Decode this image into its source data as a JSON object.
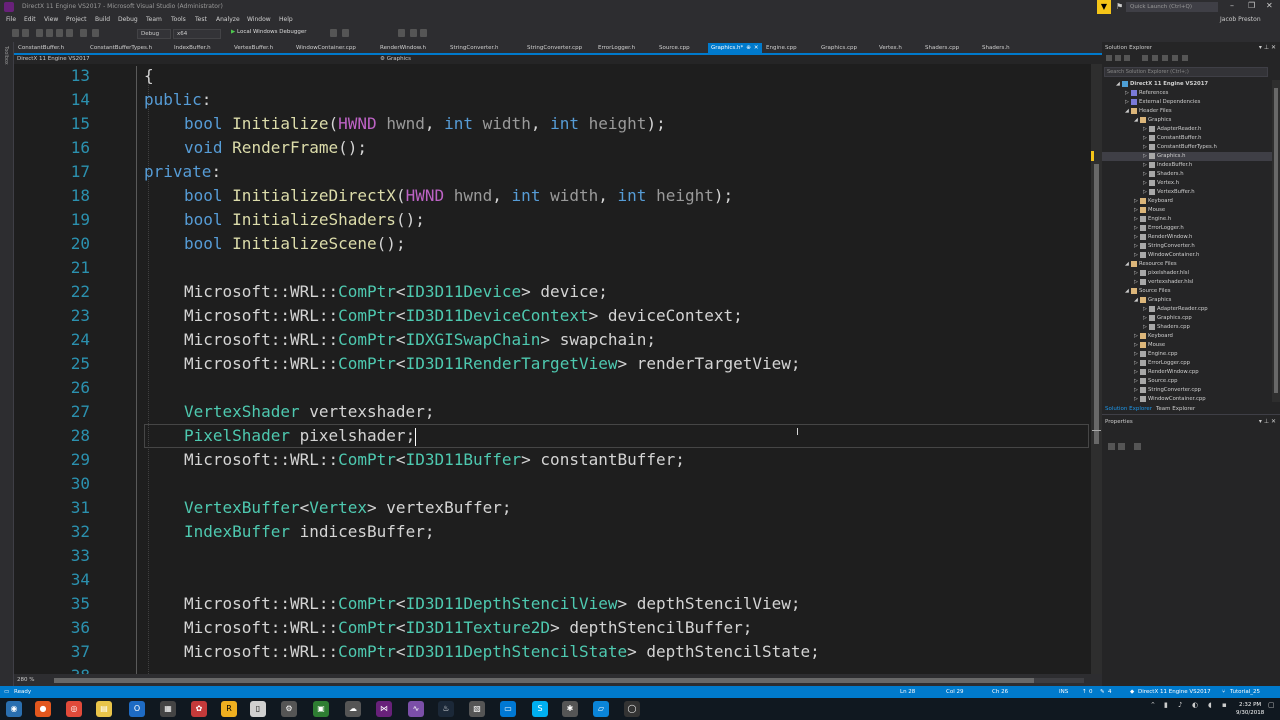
{
  "window": {
    "title": "DirectX 11 Engine VS2017 - Microsoft Visual Studio (Administrator)",
    "quick_launch": "Quick Launch (Ctrl+Q)",
    "user": "Jacob Preston"
  },
  "menu": [
    "File",
    "Edit",
    "View",
    "Project",
    "Build",
    "Debug",
    "Team",
    "Tools",
    "Test",
    "Analyze",
    "Window",
    "Help"
  ],
  "toolbar": {
    "config": "Debug",
    "platform": "x64",
    "start_label": "Local Windows Debugger"
  },
  "toolbox_label": "Toolbox",
  "tabs": [
    {
      "label": "ConstantBuffer.h"
    },
    {
      "label": "ConstantBufferTypes.h"
    },
    {
      "label": "IndexBuffer.h"
    },
    {
      "label": "VertexBuffer.h"
    },
    {
      "label": "WindowContainer.cpp"
    },
    {
      "label": "RenderWindow.h"
    },
    {
      "label": "StringConverter.h"
    },
    {
      "label": "StringConverter.cpp"
    },
    {
      "label": "ErrorLogger.h"
    },
    {
      "label": "Source.cpp"
    },
    {
      "label": "Graphics.h*",
      "active": true
    },
    {
      "label": "Engine.cpp"
    },
    {
      "label": "Graphics.cpp"
    },
    {
      "label": "Vertex.h"
    },
    {
      "label": "Shaders.cpp"
    },
    {
      "label": "Shaders.h"
    }
  ],
  "navbar": {
    "project": "DirectX 11 Engine VS2017",
    "scope": "Graphics"
  },
  "editor": {
    "zoom": "280 %",
    "lines": [
      {
        "n": "13",
        "tokens": [
          [
            "pl",
            "{"
          ]
        ]
      },
      {
        "n": "14",
        "tokens": [
          [
            "kw",
            "public"
          ],
          [
            "pl",
            ":"
          ]
        ]
      },
      {
        "n": "15",
        "indent": 1,
        "tokens": [
          [
            "kw",
            "bool"
          ],
          [
            "pl",
            " "
          ],
          [
            "fn",
            "Initialize"
          ],
          [
            "pl",
            "("
          ],
          [
            "mac",
            "HWND"
          ],
          [
            "pl",
            " "
          ],
          [
            "prm",
            "hwnd"
          ],
          [
            "pl",
            ", "
          ],
          [
            "kw",
            "int"
          ],
          [
            "pl",
            " "
          ],
          [
            "prm",
            "width"
          ],
          [
            "pl",
            ", "
          ],
          [
            "kw",
            "int"
          ],
          [
            "pl",
            " "
          ],
          [
            "prm",
            "height"
          ],
          [
            "pl",
            ");"
          ]
        ]
      },
      {
        "n": "16",
        "indent": 1,
        "tokens": [
          [
            "kw",
            "void"
          ],
          [
            "pl",
            " "
          ],
          [
            "fn",
            "RenderFrame"
          ],
          [
            "pl",
            "();"
          ]
        ]
      },
      {
        "n": "17",
        "tokens": [
          [
            "kw",
            "private"
          ],
          [
            "pl",
            ":"
          ]
        ]
      },
      {
        "n": "18",
        "indent": 1,
        "tokens": [
          [
            "kw",
            "bool"
          ],
          [
            "pl",
            " "
          ],
          [
            "fn",
            "InitializeDirectX"
          ],
          [
            "pl",
            "("
          ],
          [
            "mac",
            "HWND"
          ],
          [
            "pl",
            " "
          ],
          [
            "prm",
            "hwnd"
          ],
          [
            "pl",
            ", "
          ],
          [
            "kw",
            "int"
          ],
          [
            "pl",
            " "
          ],
          [
            "prm",
            "width"
          ],
          [
            "pl",
            ", "
          ],
          [
            "kw",
            "int"
          ],
          [
            "pl",
            " "
          ],
          [
            "prm",
            "height"
          ],
          [
            "pl",
            ");"
          ]
        ]
      },
      {
        "n": "19",
        "indent": 1,
        "tokens": [
          [
            "kw",
            "bool"
          ],
          [
            "pl",
            " "
          ],
          [
            "fn",
            "InitializeShaders"
          ],
          [
            "pl",
            "();"
          ]
        ]
      },
      {
        "n": "20",
        "indent": 1,
        "tokens": [
          [
            "kw",
            "bool"
          ],
          [
            "pl",
            " "
          ],
          [
            "fn",
            "InitializeScene"
          ],
          [
            "pl",
            "();"
          ]
        ]
      },
      {
        "n": "21",
        "tokens": []
      },
      {
        "n": "22",
        "indent": 1,
        "tokens": [
          [
            "pl",
            "Microsoft::WRL::"
          ],
          [
            "ty",
            "ComPtr"
          ],
          [
            "pl",
            "<"
          ],
          [
            "ty",
            "ID3D11Device"
          ],
          [
            "pl",
            "> device;"
          ]
        ]
      },
      {
        "n": "23",
        "indent": 1,
        "tokens": [
          [
            "pl",
            "Microsoft::WRL::"
          ],
          [
            "ty",
            "ComPtr"
          ],
          [
            "pl",
            "<"
          ],
          [
            "ty",
            "ID3D11DeviceContext"
          ],
          [
            "pl",
            "> deviceContext;"
          ]
        ]
      },
      {
        "n": "24",
        "indent": 1,
        "tokens": [
          [
            "pl",
            "Microsoft::WRL::"
          ],
          [
            "ty",
            "ComPtr"
          ],
          [
            "pl",
            "<"
          ],
          [
            "ty",
            "IDXGISwapChain"
          ],
          [
            "pl",
            "> swapchain;"
          ]
        ]
      },
      {
        "n": "25",
        "indent": 1,
        "tokens": [
          [
            "pl",
            "Microsoft::WRL::"
          ],
          [
            "ty",
            "ComPtr"
          ],
          [
            "pl",
            "<"
          ],
          [
            "ty",
            "ID3D11RenderTargetView"
          ],
          [
            "pl",
            "> renderTargetView;"
          ]
        ]
      },
      {
        "n": "26",
        "tokens": []
      },
      {
        "n": "27",
        "indent": 1,
        "tokens": [
          [
            "ty",
            "VertexShader"
          ],
          [
            "pl",
            " vertexshader;"
          ]
        ]
      },
      {
        "n": "28",
        "indent": 1,
        "current": true,
        "tokens": [
          [
            "ty",
            "PixelShader"
          ],
          [
            "pl",
            " pixelshader;"
          ]
        ]
      },
      {
        "n": "29",
        "indent": 1,
        "tokens": [
          [
            "pl",
            "Microsoft::WRL::"
          ],
          [
            "ty",
            "ComPtr"
          ],
          [
            "pl",
            "<"
          ],
          [
            "ty",
            "ID3D11Buffer"
          ],
          [
            "pl",
            "> constantBuffer;"
          ]
        ]
      },
      {
        "n": "30",
        "tokens": []
      },
      {
        "n": "31",
        "indent": 1,
        "tokens": [
          [
            "ty",
            "VertexBuffer"
          ],
          [
            "pl",
            "<"
          ],
          [
            "ty",
            "Vertex"
          ],
          [
            "pl",
            "> vertexBuffer;"
          ]
        ]
      },
      {
        "n": "32",
        "indent": 1,
        "tokens": [
          [
            "ty",
            "IndexBuffer"
          ],
          [
            "pl",
            " indicesBuffer;"
          ]
        ]
      },
      {
        "n": "33",
        "tokens": []
      },
      {
        "n": "34",
        "tokens": []
      },
      {
        "n": "35",
        "indent": 1,
        "tokens": [
          [
            "pl",
            "Microsoft::WRL::"
          ],
          [
            "ty",
            "ComPtr"
          ],
          [
            "pl",
            "<"
          ],
          [
            "ty",
            "ID3D11DepthStencilView"
          ],
          [
            "pl",
            "> depthStencilView;"
          ]
        ]
      },
      {
        "n": "36",
        "indent": 1,
        "tokens": [
          [
            "pl",
            "Microsoft::WRL::"
          ],
          [
            "ty",
            "ComPtr"
          ],
          [
            "pl",
            "<"
          ],
          [
            "ty",
            "ID3D11Texture2D"
          ],
          [
            "pl",
            "> depthStencilBuffer;"
          ]
        ]
      },
      {
        "n": "37",
        "indent": 1,
        "tokens": [
          [
            "pl",
            "Microsoft::WRL::"
          ],
          [
            "ty",
            "ComPtr"
          ],
          [
            "pl",
            "<"
          ],
          [
            "ty",
            "ID3D11DepthStencilState"
          ],
          [
            "pl",
            "> depthStencilState;"
          ]
        ]
      },
      {
        "n": "38",
        "tokens": []
      }
    ]
  },
  "solution_explorer": {
    "title": "Solution Explorer",
    "search_placeholder": "Search Solution Explorer (Ctrl+;)",
    "tabs": [
      "Solution Explorer",
      "Team Explorer"
    ],
    "tree": [
      {
        "label": "DirectX 11 Engine VS2017",
        "depth": 0,
        "icon": "proj",
        "arrow": "down",
        "bold": true
      },
      {
        "label": "References",
        "depth": 1,
        "icon": "ref",
        "arrow": "right"
      },
      {
        "label": "External Dependencies",
        "depth": 1,
        "icon": "ref",
        "arrow": "right"
      },
      {
        "label": "Header Files",
        "depth": 1,
        "icon": "folder",
        "arrow": "down"
      },
      {
        "label": "Graphics",
        "depth": 2,
        "icon": "folder",
        "arrow": "down"
      },
      {
        "label": "AdapterReader.h",
        "depth": 3,
        "icon": "file",
        "arrow": "right"
      },
      {
        "label": "ConstantBuffer.h",
        "depth": 3,
        "icon": "file",
        "arrow": "right"
      },
      {
        "label": "ConstantBufferTypes.h",
        "depth": 3,
        "icon": "file",
        "arrow": "right"
      },
      {
        "label": "Graphics.h",
        "depth": 3,
        "icon": "file",
        "arrow": "right",
        "selected": true
      },
      {
        "label": "IndexBuffer.h",
        "depth": 3,
        "icon": "file",
        "arrow": "right"
      },
      {
        "label": "Shaders.h",
        "depth": 3,
        "icon": "file",
        "arrow": "right"
      },
      {
        "label": "Vertex.h",
        "depth": 3,
        "icon": "file",
        "arrow": "right"
      },
      {
        "label": "VertexBuffer.h",
        "depth": 3,
        "icon": "file",
        "arrow": "right"
      },
      {
        "label": "Keyboard",
        "depth": 2,
        "icon": "folder",
        "arrow": "right"
      },
      {
        "label": "Mouse",
        "depth": 2,
        "icon": "folder",
        "arrow": "right"
      },
      {
        "label": "Engine.h",
        "depth": 2,
        "icon": "file",
        "arrow": "right"
      },
      {
        "label": "ErrorLogger.h",
        "depth": 2,
        "icon": "file",
        "arrow": "right"
      },
      {
        "label": "RenderWindow.h",
        "depth": 2,
        "icon": "file",
        "arrow": "right"
      },
      {
        "label": "StringConverter.h",
        "depth": 2,
        "icon": "file",
        "arrow": "right"
      },
      {
        "label": "WindowContainer.h",
        "depth": 2,
        "icon": "file",
        "arrow": "right"
      },
      {
        "label": "Resource Files",
        "depth": 1,
        "icon": "folder",
        "arrow": "down"
      },
      {
        "label": "pixelshader.hlsl",
        "depth": 2,
        "icon": "file",
        "arrow": "right"
      },
      {
        "label": "vertexshader.hlsl",
        "depth": 2,
        "icon": "file",
        "arrow": "right"
      },
      {
        "label": "Source Files",
        "depth": 1,
        "icon": "folder",
        "arrow": "down"
      },
      {
        "label": "Graphics",
        "depth": 2,
        "icon": "folder",
        "arrow": "down"
      },
      {
        "label": "AdapterReader.cpp",
        "depth": 3,
        "icon": "file",
        "arrow": "right"
      },
      {
        "label": "Graphics.cpp",
        "depth": 3,
        "icon": "file",
        "arrow": "right"
      },
      {
        "label": "Shaders.cpp",
        "depth": 3,
        "icon": "file",
        "arrow": "right"
      },
      {
        "label": "Keyboard",
        "depth": 2,
        "icon": "folder",
        "arrow": "right"
      },
      {
        "label": "Mouse",
        "depth": 2,
        "icon": "folder",
        "arrow": "right"
      },
      {
        "label": "Engine.cpp",
        "depth": 2,
        "icon": "file",
        "arrow": "right"
      },
      {
        "label": "ErrorLogger.cpp",
        "depth": 2,
        "icon": "file",
        "arrow": "right"
      },
      {
        "label": "RenderWindow.cpp",
        "depth": 2,
        "icon": "file",
        "arrow": "right"
      },
      {
        "label": "Source.cpp",
        "depth": 2,
        "icon": "file",
        "arrow": "right"
      },
      {
        "label": "StringConverter.cpp",
        "depth": 2,
        "icon": "file",
        "arrow": "right"
      },
      {
        "label": "WindowContainer.cpp",
        "depth": 2,
        "icon": "file",
        "arrow": "right"
      }
    ]
  },
  "properties": {
    "title": "Properties"
  },
  "status": {
    "ready": "Ready",
    "ln": "Ln 28",
    "col": "Col 29",
    "ch": "Ch 26",
    "ins": "INS",
    "errors": "0",
    "warnings": "4",
    "project": "DirectX 11 Engine VS2017",
    "branch": "Tutorial_25"
  },
  "taskbar": {
    "time": "2:32 PM",
    "date": "9/30/2018"
  },
  "colors": {
    "accent": "#007acc",
    "keyword": "#569cd6",
    "type": "#4ec9b0",
    "macro": "#bd63c5",
    "param": "#9a9a9a",
    "function": "#dcdcaa",
    "line_number": "#2b91af"
  }
}
